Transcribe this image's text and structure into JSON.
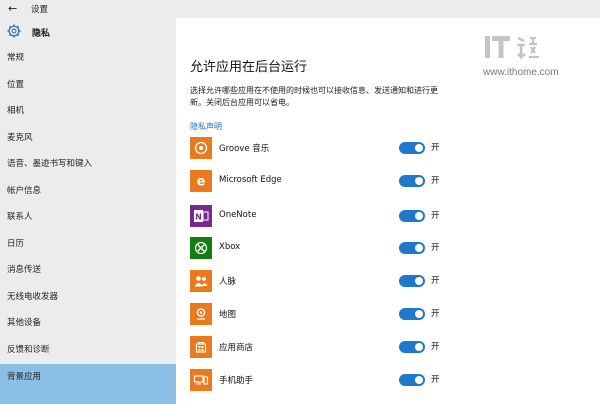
{
  "window": {
    "back_glyph": "←",
    "title": "设置"
  },
  "sidebar": {
    "section_title": "隐私",
    "items": [
      {
        "label": "常规",
        "active": false
      },
      {
        "label": "位置",
        "active": false
      },
      {
        "label": "相机",
        "active": false
      },
      {
        "label": "麦克风",
        "active": false
      },
      {
        "label": "语音、墨迹书写和键入",
        "active": false
      },
      {
        "label": "帐户信息",
        "active": false
      },
      {
        "label": "联系人",
        "active": false
      },
      {
        "label": "日历",
        "active": false
      },
      {
        "label": "消息传送",
        "active": false
      },
      {
        "label": "无线电收发器",
        "active": false
      },
      {
        "label": "其他设备",
        "active": false
      },
      {
        "label": "反馈和诊断",
        "active": false
      },
      {
        "label": "背景应用",
        "active": true
      }
    ]
  },
  "main": {
    "title": "允许应用在后台运行",
    "description": "选择允许哪些应用在不使用的时候也可以接收信息、发送通知和进行更新。关闭后台应用可以省电。",
    "privacy_link": "隐私声明",
    "apps": [
      {
        "name": "Groove 音乐",
        "icon": "groove-music-icon",
        "icon_color": "#e77b1e",
        "toggle_label": "开",
        "on": true
      },
      {
        "name": "Microsoft Edge",
        "icon": "edge-icon",
        "icon_color": "#e77b1e",
        "toggle_label": "开",
        "on": true
      },
      {
        "name": "OneNote",
        "icon": "onenote-icon",
        "icon_color": "#7a2a8c",
        "toggle_label": "开",
        "on": true
      },
      {
        "name": "Xbox",
        "icon": "xbox-icon",
        "icon_color": "#157c11",
        "toggle_label": "开",
        "on": true
      },
      {
        "name": "人脉",
        "icon": "people-icon",
        "icon_color": "#e77b1e",
        "toggle_label": "开",
        "on": true
      },
      {
        "name": "地图",
        "icon": "maps-icon",
        "icon_color": "#e77b1e",
        "toggle_label": "开",
        "on": true
      },
      {
        "name": "应用商店",
        "icon": "store-icon",
        "icon_color": "#e77b1e",
        "toggle_label": "开",
        "on": true
      },
      {
        "name": "手机助手",
        "icon": "phone-companion-icon",
        "icon_color": "#e77b1e",
        "toggle_label": "开",
        "on": true
      }
    ]
  },
  "watermark": {
    "logo_text": "IT之家",
    "url": "www.ithome.com"
  },
  "colors": {
    "accent": "#1f78cc",
    "sidebar_bg": "#ececec",
    "active_item": "#8bbfe6",
    "link": "#1a73c7"
  }
}
